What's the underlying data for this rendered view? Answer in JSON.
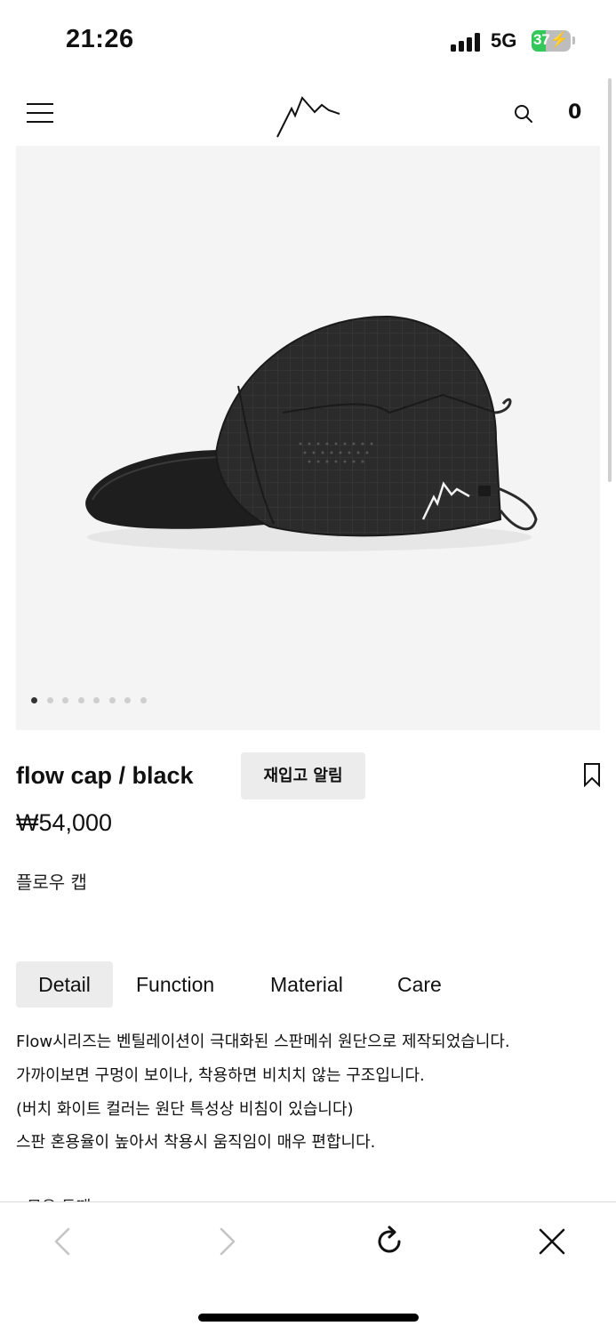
{
  "status_bar": {
    "time": "21:26",
    "network": "5G",
    "battery": "37",
    "battery_level": 0.37,
    "battery_charging_icon": "bolt-icon"
  },
  "header": {
    "menu_icon": "hamburger-menu-icon",
    "logo_icon": "mountain-logo-icon",
    "search_icon": "search-icon",
    "cart_count": "0"
  },
  "product": {
    "image_alt_icon": "black-cap-image",
    "carousel": {
      "count": 8,
      "active_index": 0
    },
    "name": "flow cap / black",
    "restock_label": "재입고 알림",
    "bookmark_icon": "bookmark-icon",
    "price": "₩54,000",
    "subtitle": "플로우 캡"
  },
  "tabs": [
    {
      "label": "Detail",
      "active": true
    },
    {
      "label": "Function",
      "active": false
    },
    {
      "label": "Material",
      "active": false
    },
    {
      "label": "Care",
      "active": false
    }
  ],
  "description": {
    "lines": [
      "Flow시리즈는 벤틸레이션이 극대화된 스판메쉬 원단으로 제작되었습니다.",
      "가까이보면 구멍이 보이나, 착용하면 비치치 않는 구조입니다.",
      "(버치 화이트 컬러는 원단 특성상 비침이 있습니다)",
      "스판 혼용율이 높아서 착용시 움직임이 매우 편합니다."
    ],
    "partial_line": "- 모우 두깨"
  },
  "browser_toolbar": {
    "back_icon": "chevron-left-icon",
    "forward_icon": "chevron-right-icon",
    "reload_icon": "reload-icon",
    "close_icon": "close-icon"
  },
  "colors": {
    "text": "#111111",
    "tab_active_bg": "#ececec",
    "battery_green": "#34c759",
    "image_bg": "#f4f4f4"
  }
}
